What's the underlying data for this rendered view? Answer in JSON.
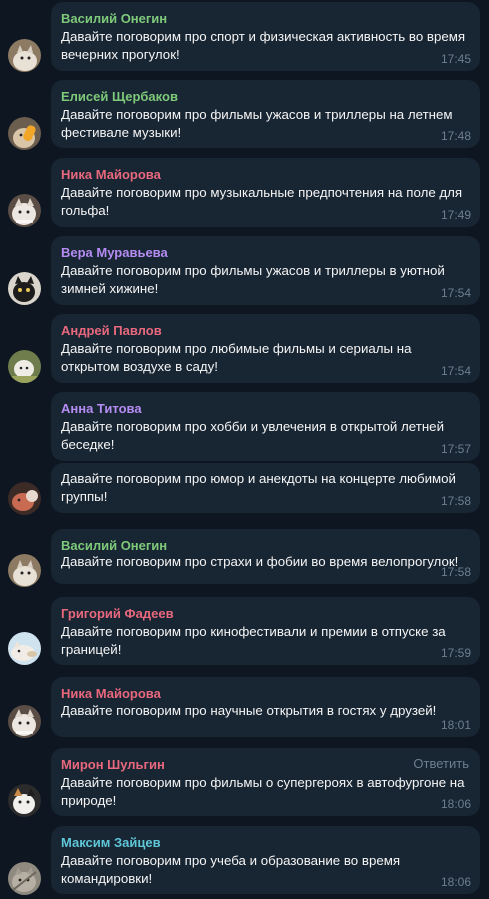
{
  "colors": {
    "background": "#0e1621",
    "bubble": "#182533",
    "text": "#f5f5f5",
    "meta": "#6d7f8f"
  },
  "messages": [
    {
      "sender": "Василий Онегин",
      "sender_color": "#7ec97a",
      "text": "Давайте поговорим про спорт и физическая активность во время вечерних прогулок!",
      "time": "17:45",
      "avatar_icon": "cat-avatar-icon"
    },
    {
      "sender": "Елисей Щербаков",
      "sender_color": "#7ec97a",
      "text": "Давайте поговорим про фильмы ужасов и триллеры на летнем фестивале музыки!",
      "time": "17:48",
      "avatar_icon": "cat-avatar-icon"
    },
    {
      "sender": "Ника Майорова",
      "sender_color": "#e8687d",
      "text": "Давайте поговорим про музыкальные предпочтения на поле для гольфа!",
      "time": "17:49",
      "avatar_icon": "cat-avatar-icon"
    },
    {
      "sender": "Вера Муравьева",
      "sender_color": "#b48cf2",
      "text": "Давайте поговорим про фильмы ужасов и триллеры в уютной зимней хижине!",
      "time": "17:54",
      "avatar_icon": "cat-avatar-icon"
    },
    {
      "sender": "Андрей Павлов",
      "sender_color": "#e8687d",
      "text": "Давайте поговорим про любимые фильмы и сериалы на открытом воздухе в саду!",
      "time": "17:54",
      "avatar_icon": "cat-avatar-icon"
    },
    {
      "sender": "Анна Титова",
      "sender_color": "#b48cf2",
      "text": "Давайте поговорим про хобби и увлечения в открытой летней беседке!",
      "time": "17:57",
      "avatar_icon": "cat-avatar-icon"
    },
    {
      "sender": "",
      "sender_color": "#b48cf2",
      "text": "Давайте поговорим про юмор и анекдоты на концерте любимой группы!",
      "time": "17:58",
      "avatar_icon": "cat-avatar-icon"
    },
    {
      "sender": "Василий Онегин",
      "sender_color": "#7ec97a",
      "text": "Давайте поговорим про страхи и фобии во время велопрогулок!",
      "time": "17:58",
      "avatar_icon": "cat-avatar-icon"
    },
    {
      "sender": "Григорий Фадеев",
      "sender_color": "#e8687d",
      "text": "Давайте поговорим про кинофестивали и премии в отпуске за границей!",
      "time": "17:59",
      "avatar_icon": "cat-avatar-icon"
    },
    {
      "sender": "Ника Майорова",
      "sender_color": "#e8687d",
      "text": "Давайте поговорим про научные открытия в гостях у друзей!",
      "time": "18:01",
      "avatar_icon": "cat-avatar-icon"
    },
    {
      "sender": "Мирон Шульгин",
      "sender_color": "#e8687d",
      "text": "Давайте поговорим про фильмы о супергероях в автофургоне на природе!",
      "time": "18:06",
      "avatar_icon": "cat-avatar-icon",
      "reply_label": "Ответить"
    },
    {
      "sender": "Максим Зайцев",
      "sender_color": "#5fc6d8",
      "text": "Давайте поговорим про учеба и образование во время командировки!",
      "time": "18:06",
      "avatar_icon": "cat-avatar-icon"
    }
  ]
}
